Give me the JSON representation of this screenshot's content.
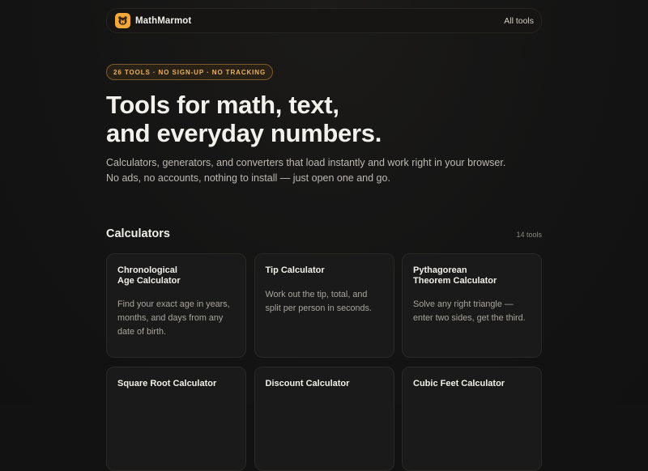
{
  "nav": {
    "brand": "MathMarmot",
    "link": "All tools"
  },
  "badge": "26 TOOLS · NO SIGN-UP · NO TRACKING",
  "hero": {
    "title_line1": "Tools for math, text,",
    "title_line2": "and everyday numbers.",
    "subtitle": "Calculators, generators, and converters that load instantly and work right in your browser. No ads, no accounts, nothing to install — just open one and go."
  },
  "section": {
    "title": "Calculators",
    "count": "14 tools"
  },
  "cards": [
    {
      "title": "Chronological\nAge Calculator",
      "desc": "Find your exact age in years, months, and days from any date of birth."
    },
    {
      "title": "Tip Calculator",
      "desc": "Work out the tip, total, and split per person in seconds."
    },
    {
      "title": "Pythagorean\nTheorem Calculator",
      "desc": "Solve any right triangle — enter two sides, get the third."
    },
    {
      "title": "Square Root Calculator",
      "desc": ""
    },
    {
      "title": "Discount Calculator",
      "desc": ""
    },
    {
      "title": "Cubic Feet Calculator",
      "desc": ""
    }
  ],
  "colors": {
    "accent": "#f2a93b",
    "badge_text": "#e8b25c",
    "background": "#121212",
    "card": "#1a1a1a"
  }
}
